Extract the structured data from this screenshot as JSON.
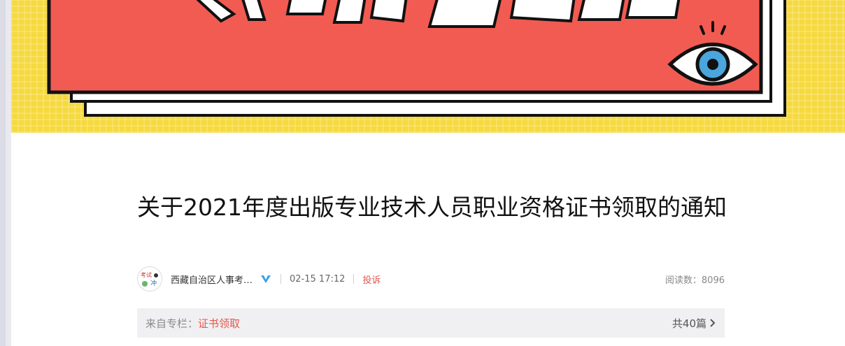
{
  "banner": {
    "description_icons": [
      "eye-icon"
    ],
    "colors": {
      "yellow": "#f6d93f",
      "red": "#f25b52",
      "ink": "#111111"
    }
  },
  "article": {
    "title": "关于2021年度出版专业技术人员职业资格证书领取的通知"
  },
  "meta": {
    "author": "西藏自治区人事考…",
    "time": "02-15 17:12",
    "report_label": "投诉",
    "reads_label": "阅读数：8096"
  },
  "column": {
    "from_label": "来自专栏：",
    "name": "证书领取",
    "count_label": "共40篇"
  }
}
